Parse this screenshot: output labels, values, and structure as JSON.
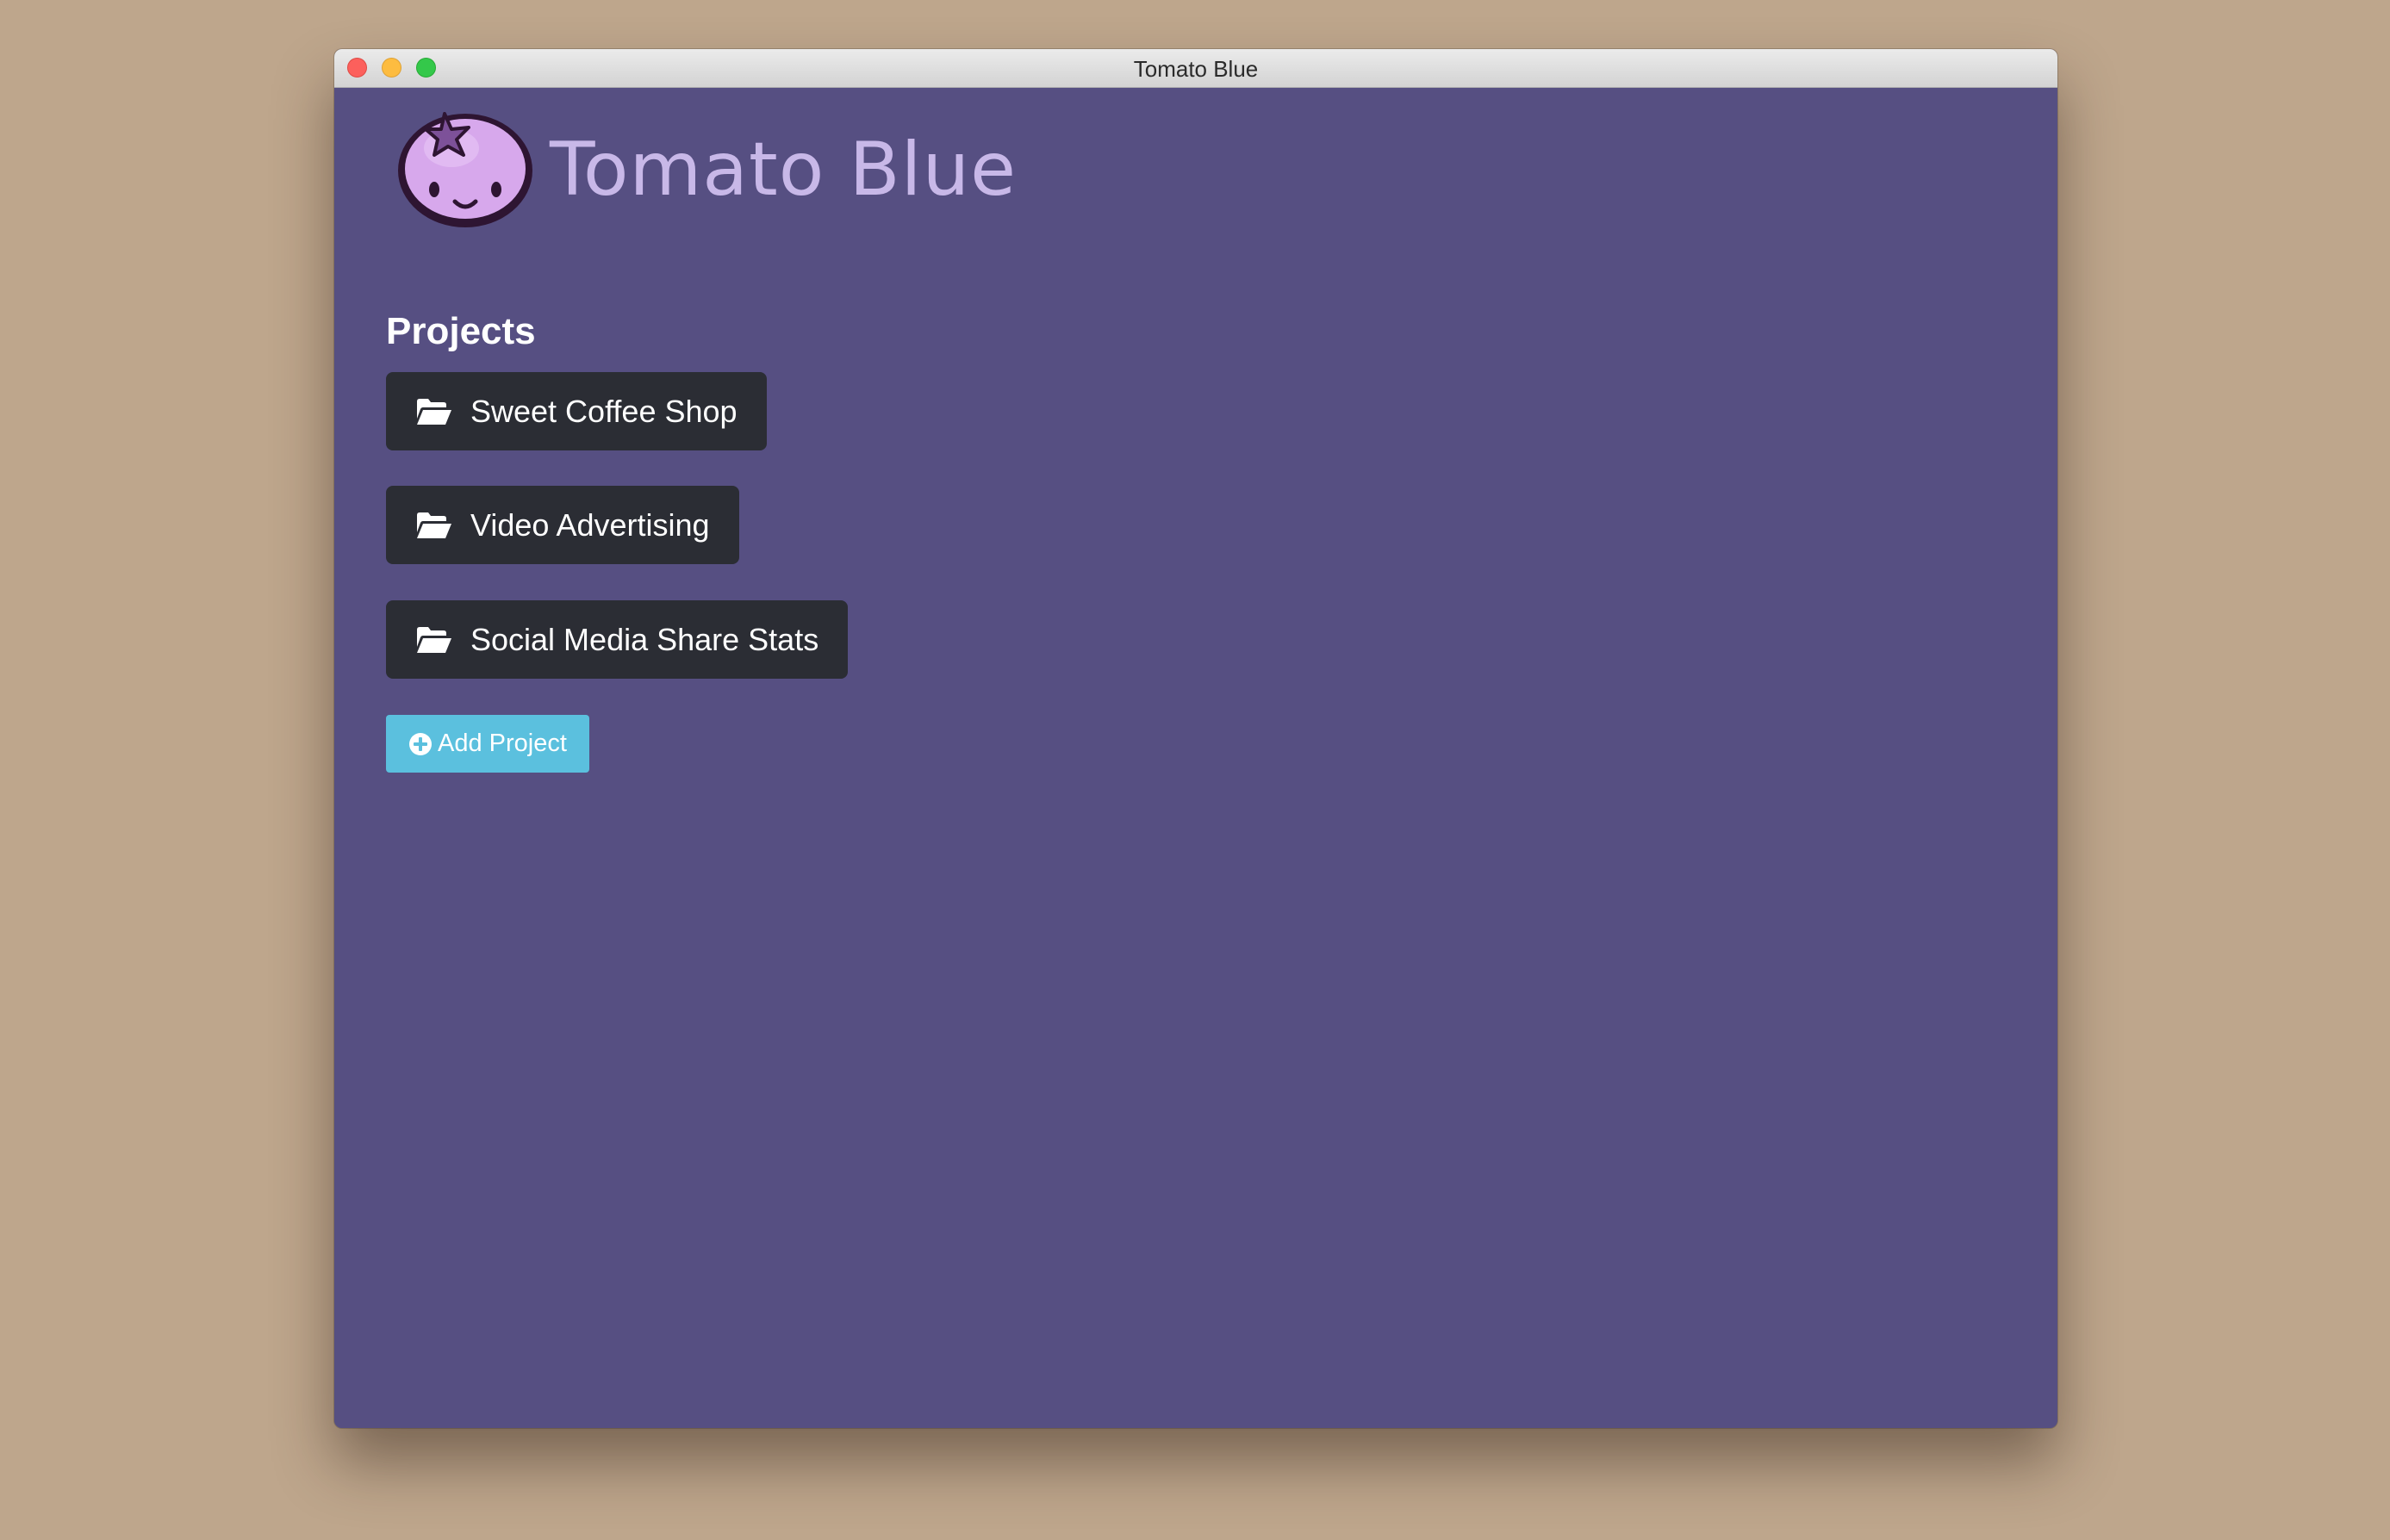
{
  "window": {
    "title": "Tomato Blue"
  },
  "app": {
    "brand_name": "Tomato Blue",
    "logo_icon": "blueberry-mascot-icon"
  },
  "projects": {
    "heading": "Projects",
    "items": [
      {
        "label": "Sweet Coffee Shop",
        "icon": "folder-open-icon"
      },
      {
        "label": "Video Advertising",
        "icon": "folder-open-icon"
      },
      {
        "label": "Social Media Share Stats",
        "icon": "folder-open-icon"
      }
    ],
    "add_button_label": "Add Project",
    "add_button_icon": "plus-circle-icon"
  },
  "colors": {
    "content_background": "#564f82",
    "project_button_background": "#2b2d34",
    "add_button_background": "#5bc0de",
    "brand_text": "#c8b8e8",
    "desktop_background": "#bea68c"
  }
}
